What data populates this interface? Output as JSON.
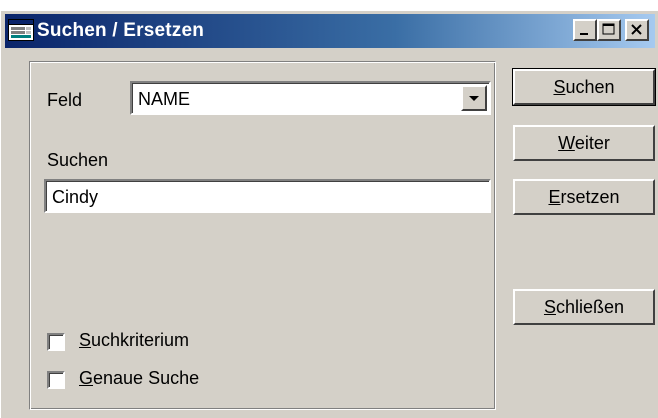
{
  "window": {
    "title": "Suchen / Ersetzen",
    "controls": {
      "minimize": "minimize",
      "maximize": "maximize",
      "close": "close"
    }
  },
  "form": {
    "field_label": "Feld",
    "field_value": "NAME",
    "search_label": "Suchen",
    "search_value": "Cindy",
    "checkbox_criteria": {
      "accel": "S",
      "rest": "uchkriterium",
      "checked": false
    },
    "checkbox_exact": {
      "accel": "G",
      "rest": "enaue Suche",
      "checked": false
    }
  },
  "buttons": {
    "search": {
      "accel": "S",
      "rest": "uchen"
    },
    "next": {
      "accel": "W",
      "rest": "eiter"
    },
    "replace": {
      "accel": "E",
      "rest": "rsetzen"
    },
    "close": {
      "accel": "S",
      "rest": "chließen"
    }
  },
  "colors": {
    "face": "#d4d0c8",
    "title_start": "#0a246a",
    "title_end": "#a6caf0"
  },
  "icons": {
    "title": "dialog-window-icon",
    "combo": "chevron-down-icon"
  }
}
